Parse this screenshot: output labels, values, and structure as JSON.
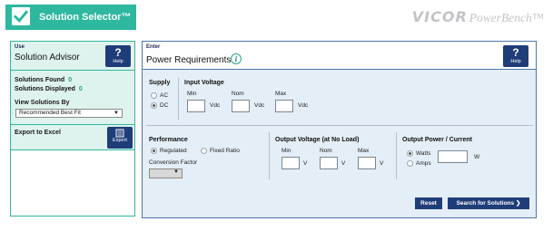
{
  "header": {
    "app_title": "Solution Selector™",
    "vendor_logo_main": "VICOR",
    "vendor_logo_sub": "PowerBench™"
  },
  "advisor": {
    "tag": "Use",
    "title": "Solution Advisor",
    "help_label": "Help",
    "solutions_found_label": "Solutions Found",
    "solutions_found_value": "0",
    "solutions_displayed_label": "Solutions Displayed",
    "solutions_displayed_value": "0",
    "view_by_label": "View Solutions By",
    "view_by_selected": "Recommended Best Fit",
    "export_label": "Export to Excel",
    "export_button_label": "Export"
  },
  "power": {
    "tag": "Enter",
    "title": "Power Requirements",
    "help_label": "Help",
    "supply": {
      "label": "Supply",
      "options": [
        "AC",
        "DC"
      ],
      "selected": "DC"
    },
    "input_voltage": {
      "label": "Input Voltage",
      "min_label": "Min",
      "nom_label": "Nom",
      "max_label": "Max",
      "unit": "Vdc",
      "min_value": "",
      "nom_value": "",
      "max_value": ""
    },
    "performance": {
      "label": "Performance",
      "options": [
        "Regulated",
        "Fixed Ratio"
      ],
      "selected": "Regulated",
      "conversion_label": "Conversion Factor",
      "conversion_value": ""
    },
    "output_voltage": {
      "label": "Output Voltage (at No Load)",
      "min_label": "Min",
      "nom_label": "Nom",
      "max_label": "Max",
      "unit": "V",
      "min_value": "",
      "nom_value": "",
      "max_value": ""
    },
    "output_power": {
      "label": "Output Power / Current",
      "options": [
        "Watts",
        "Amps"
      ],
      "selected": "Watts",
      "unit": "W",
      "value": ""
    },
    "reset_label": "Reset",
    "search_label": "Search for Solutions ❯"
  },
  "colors": {
    "brand_green": "#2db89f",
    "panel_green_bg": "#dff3ee",
    "navy": "#1f3d79",
    "panel_blue_bg": "#e4eef6",
    "count_green": "#2a9f76"
  },
  "icons": [
    "checkmark-icon",
    "question-icon",
    "info-icon",
    "export-icon",
    "chevron-down-icon"
  ]
}
